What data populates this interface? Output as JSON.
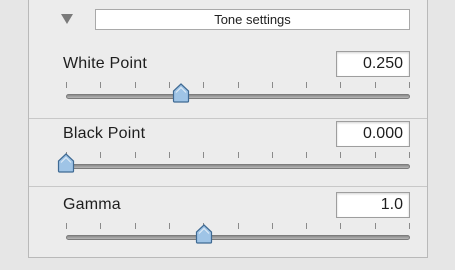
{
  "header": {
    "title": "Tone settings",
    "disclosure_icon": "triangle-down-icon"
  },
  "sliders": [
    {
      "label": "White Point",
      "value": "0.250",
      "level": 0.333
    },
    {
      "label": "Black Point",
      "value": "0.000",
      "level": 0.0
    },
    {
      "label": "Gamma",
      "value": "1.0",
      "level": 0.4
    }
  ],
  "colors": {
    "thumb_fill": "#9fc4e6",
    "thumb_stroke": "#3f6a93"
  }
}
